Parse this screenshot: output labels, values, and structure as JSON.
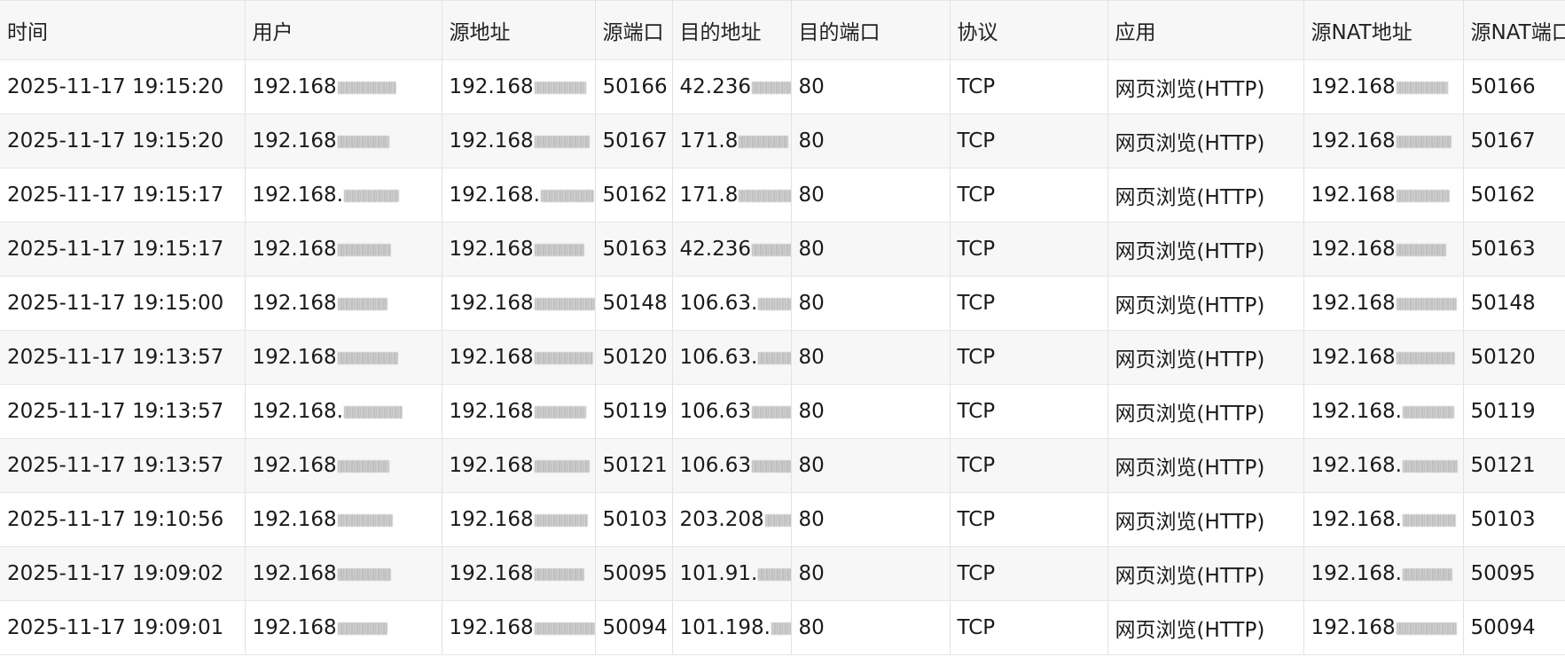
{
  "columns": [
    "时间",
    "用户",
    "源地址",
    "源端口",
    "目的地址",
    "目的端口",
    "协议",
    "应用",
    "源NAT地址",
    "源NAT端口"
  ],
  "rows": [
    {
      "time": "2025-11-17 19:15:20",
      "user": "192.168",
      "src_addr": "192.168",
      "src_port": "50166",
      "dst_addr": "42.236",
      "dst_port": "80",
      "protocol": "TCP",
      "app": "网页浏览(HTTP)",
      "nat_addr": "192.168",
      "nat_port": "50166"
    },
    {
      "time": "2025-11-17 19:15:20",
      "user": "192.168",
      "src_addr": "192.168",
      "src_port": "50167",
      "dst_addr": "171.8",
      "dst_port": "80",
      "protocol": "TCP",
      "app": "网页浏览(HTTP)",
      "nat_addr": "192.168",
      "nat_port": "50167"
    },
    {
      "time": "2025-11-17 19:15:17",
      "user": "192.168.",
      "src_addr": "192.168.",
      "src_port": "50162",
      "dst_addr": "171.8",
      "dst_port": "80",
      "protocol": "TCP",
      "app": "网页浏览(HTTP)",
      "nat_addr": "192.168",
      "nat_port": "50162"
    },
    {
      "time": "2025-11-17 19:15:17",
      "user": "192.168",
      "src_addr": "192.168",
      "src_port": "50163",
      "dst_addr": "42.236",
      "dst_port": "80",
      "protocol": "TCP",
      "app": "网页浏览(HTTP)",
      "nat_addr": "192.168",
      "nat_port": "50163"
    },
    {
      "time": "2025-11-17 19:15:00",
      "user": "192.168",
      "src_addr": "192.168",
      "src_port": "50148",
      "dst_addr": "106.63.",
      "dst_port": "80",
      "protocol": "TCP",
      "app": "网页浏览(HTTP)",
      "nat_addr": "192.168",
      "nat_port": "50148"
    },
    {
      "time": "2025-11-17 19:13:57",
      "user": "192.168",
      "src_addr": "192.168",
      "src_port": "50120",
      "dst_addr": "106.63.",
      "dst_port": "80",
      "protocol": "TCP",
      "app": "网页浏览(HTTP)",
      "nat_addr": "192.168",
      "nat_port": "50120"
    },
    {
      "time": "2025-11-17 19:13:57",
      "user": "192.168.",
      "src_addr": "192.168",
      "src_port": "50119",
      "dst_addr": "106.63",
      "dst_port": "80",
      "protocol": "TCP",
      "app": "网页浏览(HTTP)",
      "nat_addr": "192.168.",
      "nat_port": "50119"
    },
    {
      "time": "2025-11-17 19:13:57",
      "user": "192.168",
      "src_addr": "192.168",
      "src_port": "50121",
      "dst_addr": "106.63",
      "dst_port": "80",
      "protocol": "TCP",
      "app": "网页浏览(HTTP)",
      "nat_addr": "192.168.",
      "nat_port": "50121"
    },
    {
      "time": "2025-11-17 19:10:56",
      "user": "192.168",
      "src_addr": "192.168",
      "src_port": "50103",
      "dst_addr": "203.208",
      "dst_port": "80",
      "protocol": "TCP",
      "app": "网页浏览(HTTP)",
      "nat_addr": "192.168.",
      "nat_port": "50103"
    },
    {
      "time": "2025-11-17 19:09:02",
      "user": "192.168",
      "src_addr": "192.168",
      "src_port": "50095",
      "dst_addr": "101.91.",
      "dst_port": "80",
      "protocol": "TCP",
      "app": "网页浏览(HTTP)",
      "nat_addr": "192.168.",
      "nat_port": "50095"
    },
    {
      "time": "2025-11-17 19:09:01",
      "user": "192.168",
      "src_addr": "192.168",
      "src_port": "50094",
      "dst_addr": "101.198.",
      "dst_port": "80",
      "protocol": "TCP",
      "app": "网页浏览(HTTP)",
      "nat_addr": "192.168",
      "nat_port": "50094"
    }
  ]
}
